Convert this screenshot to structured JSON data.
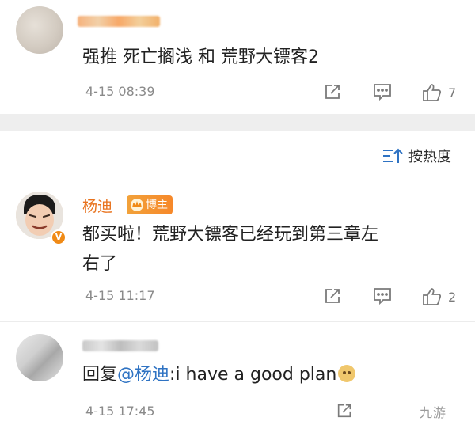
{
  "comments": [
    {
      "text": "强推 死亡搁浅 和 荒野大镖客2",
      "time": "4-15 08:39",
      "like_count": "7"
    },
    {
      "username": "杨迪",
      "badge": "博主",
      "verified_mark": "V",
      "text_line1": "都买啦！荒野大镖客已经玩到第三章左",
      "text_line2": "右了",
      "time": "4-15 11:17",
      "like_count": "2"
    },
    {
      "reply_prefix": "回复",
      "mention": "@杨迪",
      "text": ":i have a good plan",
      "time": "4-15 17:45"
    }
  ],
  "sort": {
    "label": "按热度"
  },
  "watermark": "九游",
  "icons": {
    "share": "share-icon",
    "comment": "comment-icon",
    "like": "thumbs-up-icon",
    "sort": "sort-icon",
    "emoji": "doge-emoji-icon"
  }
}
